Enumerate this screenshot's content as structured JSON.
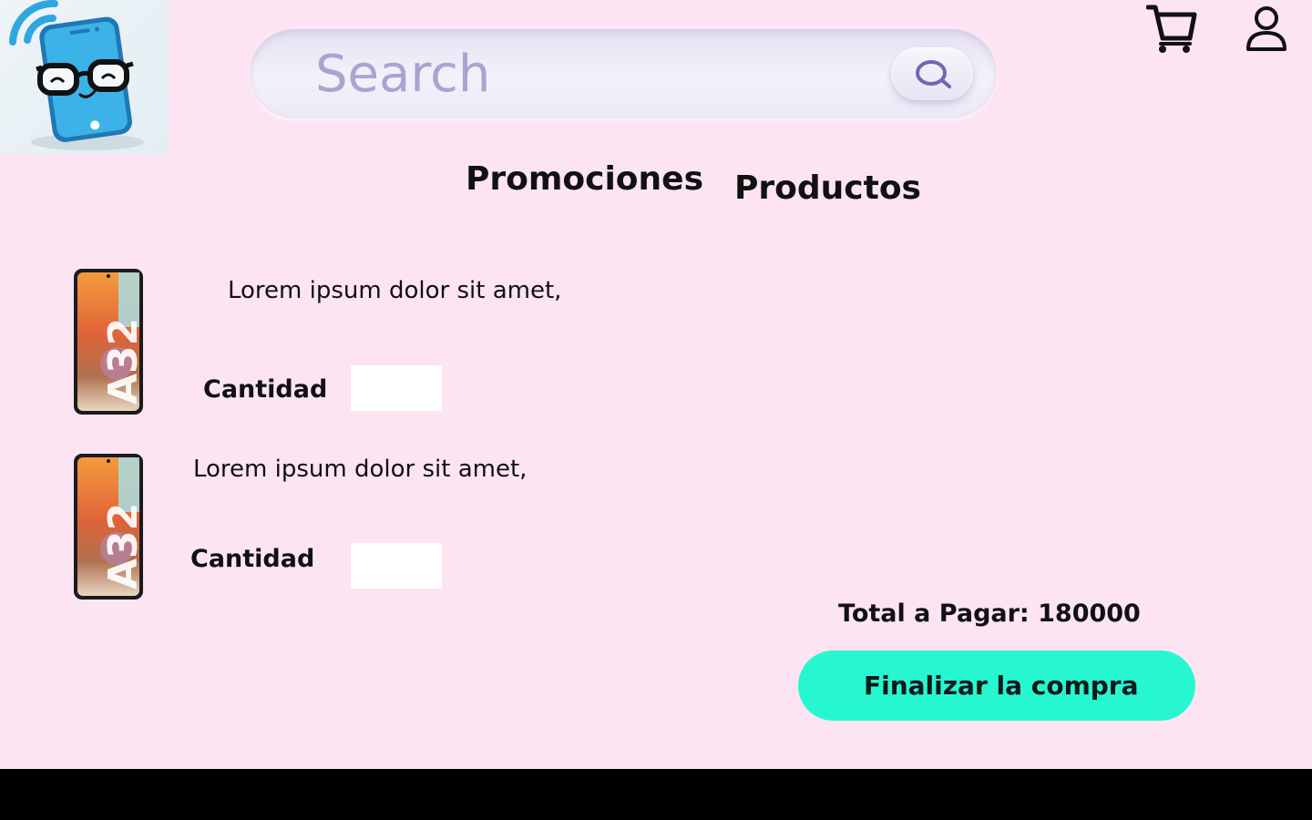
{
  "header": {
    "search_placeholder": "Search",
    "cart_icon": "shopping-cart-icon",
    "user_icon": "user-profile-icon",
    "logo": "nerdy-phone-wifi-logo"
  },
  "nav": {
    "items": [
      {
        "label": "Promociones"
      },
      {
        "label": "Productos"
      }
    ]
  },
  "cart": {
    "items": [
      {
        "description": "Lorem ipsum dolor sit amet,",
        "image_label": "A32",
        "quantity_label": "Cantidad",
        "quantity_value": ""
      },
      {
        "description": "Lorem ipsum dolor sit amet,",
        "image_label": "A32",
        "quantity_label": "Cantidad",
        "quantity_value": ""
      }
    ],
    "total_text": "Total a Pagar: 180000",
    "checkout_label": "Finalizar la compra"
  },
  "colors": {
    "background": "#fde4f3",
    "checkout_button": "#27f7d0",
    "search_text": "#a9a4d2",
    "logo_phone": "#3bb2e8"
  }
}
